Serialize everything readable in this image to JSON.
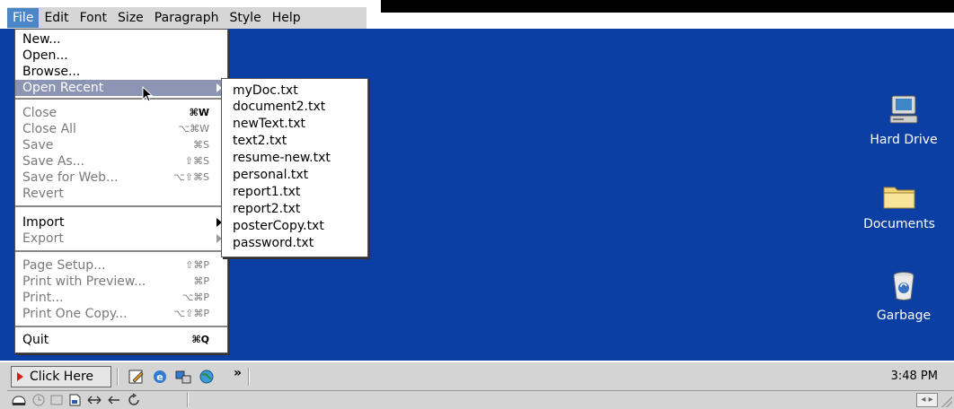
{
  "menubar": {
    "items": [
      "File",
      "Edit",
      "Font",
      "Size",
      "Paragraph",
      "Style",
      "Help"
    ]
  },
  "file_menu": {
    "items": [
      {
        "label": "New...",
        "shortcut": ""
      },
      {
        "label": "Open...",
        "shortcut": ""
      },
      {
        "label": "Browse...",
        "shortcut": ""
      },
      {
        "label": "Open Recent",
        "shortcut": ""
      },
      {
        "label": "Close",
        "shortcut": "⌘W"
      },
      {
        "label": "Close All",
        "shortcut": "⌥⌘W"
      },
      {
        "label": "Save",
        "shortcut": "⌘S"
      },
      {
        "label": "Save As...",
        "shortcut": "⇧⌘S"
      },
      {
        "label": "Save for Web...",
        "shortcut": "⌥⇧⌘S"
      },
      {
        "label": "Revert",
        "shortcut": ""
      },
      {
        "label": "Import",
        "shortcut": ""
      },
      {
        "label": "Export",
        "shortcut": ""
      },
      {
        "label": "Page Setup...",
        "shortcut": "⇧⌘P"
      },
      {
        "label": "Print with Preview...",
        "shortcut": "⌘P"
      },
      {
        "label": "Print...",
        "shortcut": "⌥⌘P"
      },
      {
        "label": "Print One Copy...",
        "shortcut": "⌥⇧⌘P"
      },
      {
        "label": "Quit",
        "shortcut": "⌘Q"
      }
    ]
  },
  "recent_files": [
    "myDoc.txt",
    "document2.txt",
    "newText.txt",
    "text2.txt",
    "resume-new.txt",
    "personal.txt",
    "report1.txt",
    "report2.txt",
    "posterCopy.txt",
    "password.txt"
  ],
  "desktop_icons": [
    {
      "label": "Hard Drive",
      "icon": "computer-icon"
    },
    {
      "label": "Documents",
      "icon": "folder-icon"
    },
    {
      "label": "Garbage",
      "icon": "trash-icon"
    }
  ],
  "taskbar": {
    "start_label": "Click Here",
    "more_label": "»",
    "clock": "3:48 PM",
    "quick_launch": [
      "edit-icon",
      "browser-icon",
      "network-icon",
      "globe-icon"
    ],
    "tray": [
      "drive-icon",
      "clock-icon",
      "window-icon",
      "document-icon",
      "swap-icon",
      "back-icon",
      "refresh-icon"
    ],
    "scroll_label": "◂ ▸"
  },
  "colors": {
    "desktop": "#0b3fa3",
    "menu_highlight": "#4a86c8",
    "submenu_highlight": "#8c96b4"
  }
}
